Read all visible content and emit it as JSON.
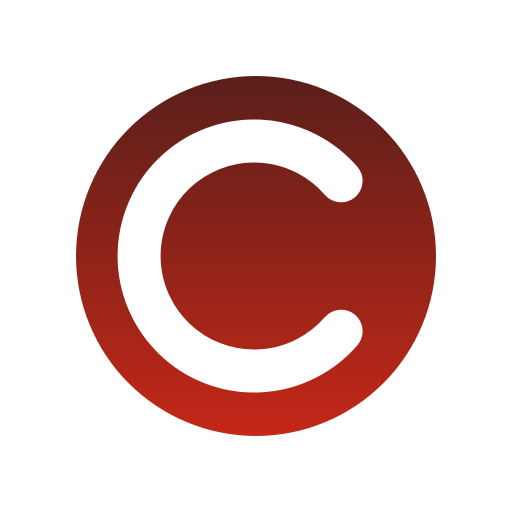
{
  "icon": {
    "name": "c-letter-logo-icon",
    "colors": {
      "background": "#ffffff",
      "circle_gradient_top": "#5a1f1a",
      "circle_gradient_bottom": "#c42818",
      "letter": "#ffffff"
    }
  }
}
